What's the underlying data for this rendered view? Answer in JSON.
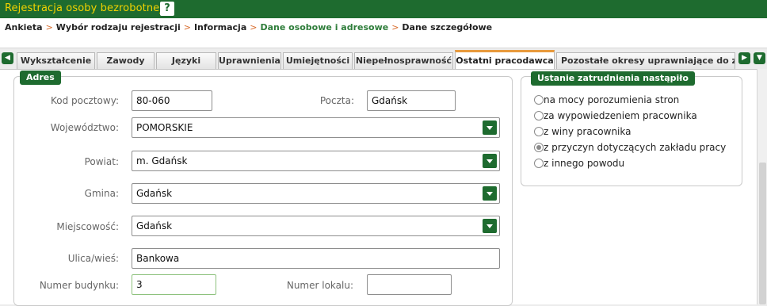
{
  "app": {
    "title": "Rejestracja osoby bezrobotnej",
    "help_label": "?"
  },
  "breadcrumb": [
    {
      "label": "Ankieta",
      "style": "bold"
    },
    {
      "label": "Wybór rodzaju rejestracji",
      "style": "bold"
    },
    {
      "label": "Informacja",
      "style": "bold"
    },
    {
      "label": "Dane osobowe i adresowe",
      "style": "green"
    },
    {
      "label": "Dane szczegółowe",
      "style": "bold"
    }
  ],
  "breadcrumb_separator": ">",
  "tabs": [
    {
      "label": "Wykształcenie"
    },
    {
      "label": "Zawody"
    },
    {
      "label": "Języki"
    },
    {
      "label": "Uprawnienia"
    },
    {
      "label": "Umiejętności"
    },
    {
      "label": "Niepełnosprawność"
    },
    {
      "label": "Ostatni pracodawca",
      "active": true
    },
    {
      "label": "Pozostałe okresy uprawniające do zasi"
    }
  ],
  "address": {
    "legend": "Adres",
    "postal_code": {
      "label": "Kod pocztowy:",
      "value": "80-060"
    },
    "post_office": {
      "label": "Poczta:",
      "value": "Gdańsk"
    },
    "voivodeship": {
      "label": "Województwo:",
      "value": "POMORSKIE"
    },
    "county": {
      "label": "Powiat:",
      "value": "m. Gdańsk"
    },
    "commune": {
      "label": "Gmina:",
      "value": "Gdańsk"
    },
    "locality": {
      "label": "Miejscowość:",
      "value": "Gdańsk"
    },
    "street": {
      "label": "Ulica/wieś:",
      "value": "Bankowa"
    },
    "building_no": {
      "label": "Numer budynku:",
      "value": "3"
    },
    "apartment_no": {
      "label": "Numer lokalu:",
      "value": ""
    }
  },
  "termination": {
    "legend": "Ustanie zatrudnienia nastąpiło",
    "options": [
      {
        "label": "na mocy porozumienia stron",
        "checked": false
      },
      {
        "label": "za wypowiedzeniem pracownika",
        "checked": false
      },
      {
        "label": "z winy pracownika",
        "checked": false
      },
      {
        "label": "z przyczyn dotyczących zakładu pracy",
        "checked": true
      },
      {
        "label": "z innego powodu",
        "checked": false
      }
    ]
  },
  "colors": {
    "brand_green": "#1e6b2f",
    "title_yellow": "#f2d200",
    "tab_active_accent": "#e89a3c",
    "separator_orange": "#d86c2c"
  }
}
